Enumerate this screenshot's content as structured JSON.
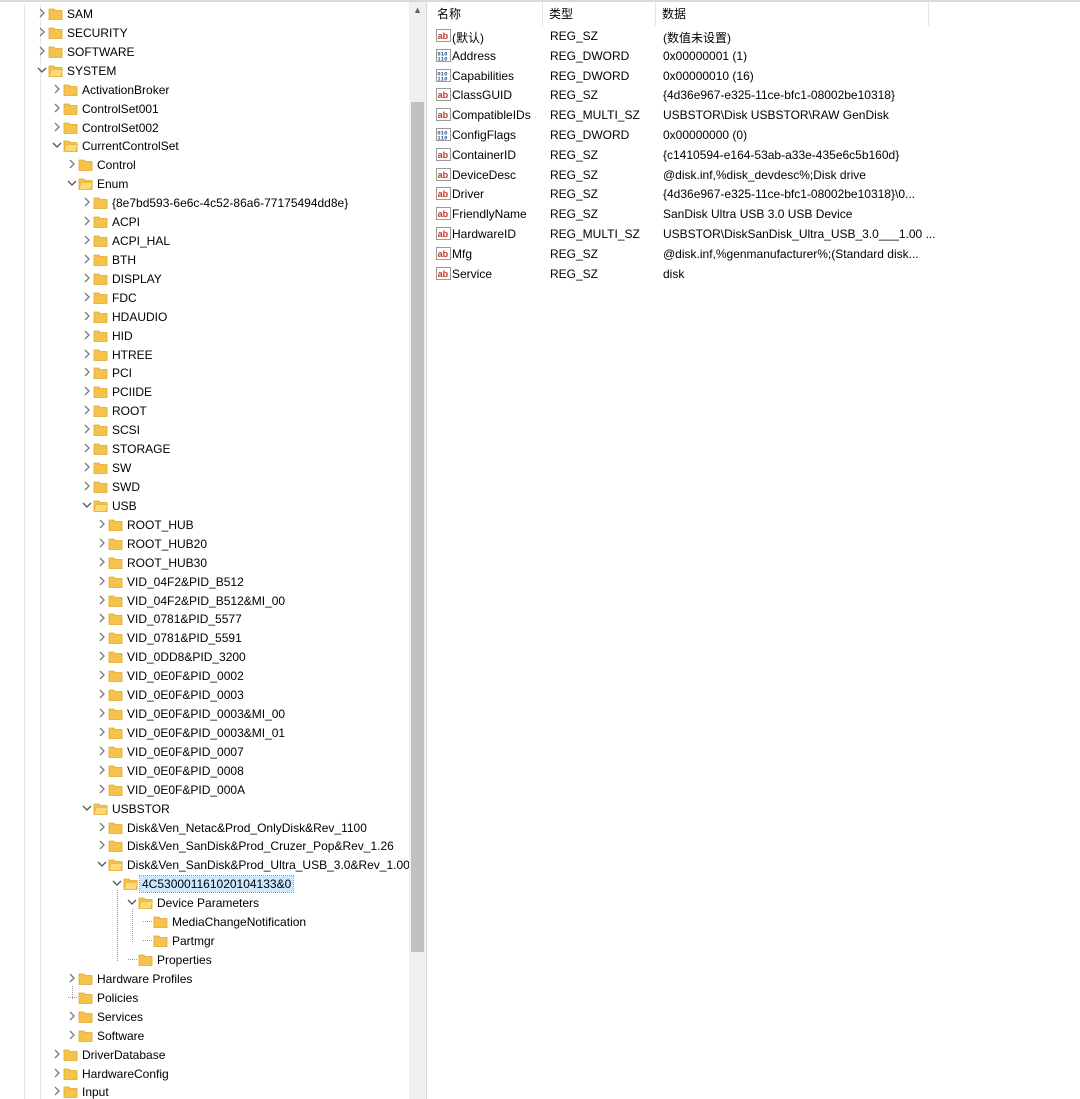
{
  "tree": {
    "rows": [
      {
        "label": "SAM",
        "depth": 0,
        "state": "collapsed"
      },
      {
        "label": "SECURITY",
        "depth": 0,
        "state": "collapsed"
      },
      {
        "label": "SOFTWARE",
        "depth": 0,
        "state": "collapsed"
      },
      {
        "label": "SYSTEM",
        "depth": 0,
        "state": "expanded"
      },
      {
        "label": "ActivationBroker",
        "depth": 1,
        "state": "collapsed"
      },
      {
        "label": "ControlSet001",
        "depth": 1,
        "state": "collapsed"
      },
      {
        "label": "ControlSet002",
        "depth": 1,
        "state": "collapsed"
      },
      {
        "label": "CurrentControlSet",
        "depth": 1,
        "state": "expanded"
      },
      {
        "label": "Control",
        "depth": 2,
        "state": "collapsed"
      },
      {
        "label": "Enum",
        "depth": 2,
        "state": "expanded"
      },
      {
        "label": "{8e7bd593-6e6c-4c52-86a6-77175494dd8e}",
        "depth": 3,
        "state": "collapsed"
      },
      {
        "label": "ACPI",
        "depth": 3,
        "state": "collapsed"
      },
      {
        "label": "ACPI_HAL",
        "depth": 3,
        "state": "collapsed"
      },
      {
        "label": "BTH",
        "depth": 3,
        "state": "collapsed"
      },
      {
        "label": "DISPLAY",
        "depth": 3,
        "state": "collapsed"
      },
      {
        "label": "FDC",
        "depth": 3,
        "state": "collapsed"
      },
      {
        "label": "HDAUDIO",
        "depth": 3,
        "state": "collapsed"
      },
      {
        "label": "HID",
        "depth": 3,
        "state": "collapsed"
      },
      {
        "label": "HTREE",
        "depth": 3,
        "state": "collapsed"
      },
      {
        "label": "PCI",
        "depth": 3,
        "state": "collapsed"
      },
      {
        "label": "PCIIDE",
        "depth": 3,
        "state": "collapsed"
      },
      {
        "label": "ROOT",
        "depth": 3,
        "state": "collapsed"
      },
      {
        "label": "SCSI",
        "depth": 3,
        "state": "collapsed"
      },
      {
        "label": "STORAGE",
        "depth": 3,
        "state": "collapsed"
      },
      {
        "label": "SW",
        "depth": 3,
        "state": "collapsed"
      },
      {
        "label": "SWD",
        "depth": 3,
        "state": "collapsed"
      },
      {
        "label": "USB",
        "depth": 3,
        "state": "expanded"
      },
      {
        "label": "ROOT_HUB",
        "depth": 4,
        "state": "collapsed"
      },
      {
        "label": "ROOT_HUB20",
        "depth": 4,
        "state": "collapsed"
      },
      {
        "label": "ROOT_HUB30",
        "depth": 4,
        "state": "collapsed"
      },
      {
        "label": "VID_04F2&PID_B512",
        "depth": 4,
        "state": "collapsed"
      },
      {
        "label": "VID_04F2&PID_B512&MI_00",
        "depth": 4,
        "state": "collapsed"
      },
      {
        "label": "VID_0781&PID_5577",
        "depth": 4,
        "state": "collapsed"
      },
      {
        "label": "VID_0781&PID_5591",
        "depth": 4,
        "state": "collapsed"
      },
      {
        "label": "VID_0DD8&PID_3200",
        "depth": 4,
        "state": "collapsed"
      },
      {
        "label": "VID_0E0F&PID_0002",
        "depth": 4,
        "state": "collapsed"
      },
      {
        "label": "VID_0E0F&PID_0003",
        "depth": 4,
        "state": "collapsed"
      },
      {
        "label": "VID_0E0F&PID_0003&MI_00",
        "depth": 4,
        "state": "collapsed"
      },
      {
        "label": "VID_0E0F&PID_0003&MI_01",
        "depth": 4,
        "state": "collapsed"
      },
      {
        "label": "VID_0E0F&PID_0007",
        "depth": 4,
        "state": "collapsed"
      },
      {
        "label": "VID_0E0F&PID_0008",
        "depth": 4,
        "state": "collapsed"
      },
      {
        "label": "VID_0E0F&PID_000A",
        "depth": 4,
        "state": "collapsed"
      },
      {
        "label": "USBSTOR",
        "depth": 3,
        "state": "expanded"
      },
      {
        "label": "Disk&Ven_Netac&Prod_OnlyDisk&Rev_1100",
        "depth": 4,
        "state": "collapsed"
      },
      {
        "label": "Disk&Ven_SanDisk&Prod_Cruzer_Pop&Rev_1.26",
        "depth": 4,
        "state": "collapsed"
      },
      {
        "label": "Disk&Ven_SanDisk&Prod_Ultra_USB_3.0&Rev_1.00",
        "depth": 4,
        "state": "expanded"
      },
      {
        "label": "4C530001161020104133&0",
        "depth": 5,
        "state": "expanded",
        "selected": true
      },
      {
        "label": "Device Parameters",
        "depth": 6,
        "state": "expanded"
      },
      {
        "label": "MediaChangeNotification",
        "depth": 7,
        "state": "leaf"
      },
      {
        "label": "Partmgr",
        "depth": 7,
        "state": "leaf"
      },
      {
        "label": "Properties",
        "depth": 6,
        "state": "leaf"
      },
      {
        "label": "Hardware Profiles",
        "depth": 2,
        "state": "collapsed"
      },
      {
        "label": "Policies",
        "depth": 2,
        "state": "leaf"
      },
      {
        "label": "Services",
        "depth": 2,
        "state": "collapsed"
      },
      {
        "label": "Software",
        "depth": 2,
        "state": "collapsed"
      },
      {
        "label": "DriverDatabase",
        "depth": 1,
        "state": "collapsed"
      },
      {
        "label": "HardwareConfig",
        "depth": 1,
        "state": "collapsed"
      },
      {
        "label": "Input",
        "depth": 1,
        "state": "collapsed"
      }
    ]
  },
  "values": {
    "columns": [
      "名称",
      "类型",
      "数据"
    ],
    "rows": [
      {
        "icon": "string-value-icon",
        "name": "(默认)",
        "type": "REG_SZ",
        "data": "(数值未设置)"
      },
      {
        "icon": "binary-value-icon",
        "name": "Address",
        "type": "REG_DWORD",
        "data": "0x00000001 (1)"
      },
      {
        "icon": "binary-value-icon",
        "name": "Capabilities",
        "type": "REG_DWORD",
        "data": "0x00000010 (16)"
      },
      {
        "icon": "string-value-icon",
        "name": "ClassGUID",
        "type": "REG_SZ",
        "data": "{4d36e967-e325-11ce-bfc1-08002be10318}"
      },
      {
        "icon": "string-value-icon",
        "name": "CompatibleIDs",
        "type": "REG_MULTI_SZ",
        "data": "USBSTOR\\Disk USBSTOR\\RAW GenDisk"
      },
      {
        "icon": "binary-value-icon",
        "name": "ConfigFlags",
        "type": "REG_DWORD",
        "data": "0x00000000 (0)"
      },
      {
        "icon": "string-value-icon",
        "name": "ContainerID",
        "type": "REG_SZ",
        "data": "{c1410594-e164-53ab-a33e-435e6c5b160d}"
      },
      {
        "icon": "string-value-icon",
        "name": "DeviceDesc",
        "type": "REG_SZ",
        "data": "@disk.inf,%disk_devdesc%;Disk drive"
      },
      {
        "icon": "string-value-icon",
        "name": "Driver",
        "type": "REG_SZ",
        "data": "{4d36e967-e325-11ce-bfc1-08002be10318}\\0..."
      },
      {
        "icon": "string-value-icon",
        "name": "FriendlyName",
        "type": "REG_SZ",
        "data": "SanDisk Ultra USB 3.0 USB Device"
      },
      {
        "icon": "string-value-icon",
        "name": "HardwareID",
        "type": "REG_MULTI_SZ",
        "data": "USBSTOR\\DiskSanDisk_Ultra_USB_3.0___1.00 ..."
      },
      {
        "icon": "string-value-icon",
        "name": "Mfg",
        "type": "REG_SZ",
        "data": "@disk.inf,%genmanufacturer%;(Standard disk..."
      },
      {
        "icon": "string-value-icon",
        "name": "Service",
        "type": "REG_SZ",
        "data": "disk"
      }
    ]
  },
  "colors": {
    "folder": "#f5c34b",
    "folder_dark": "#e0a72a",
    "selection": "#cce8ff",
    "string_icon": "#c0392b",
    "binary_icon": "#2b5797"
  }
}
